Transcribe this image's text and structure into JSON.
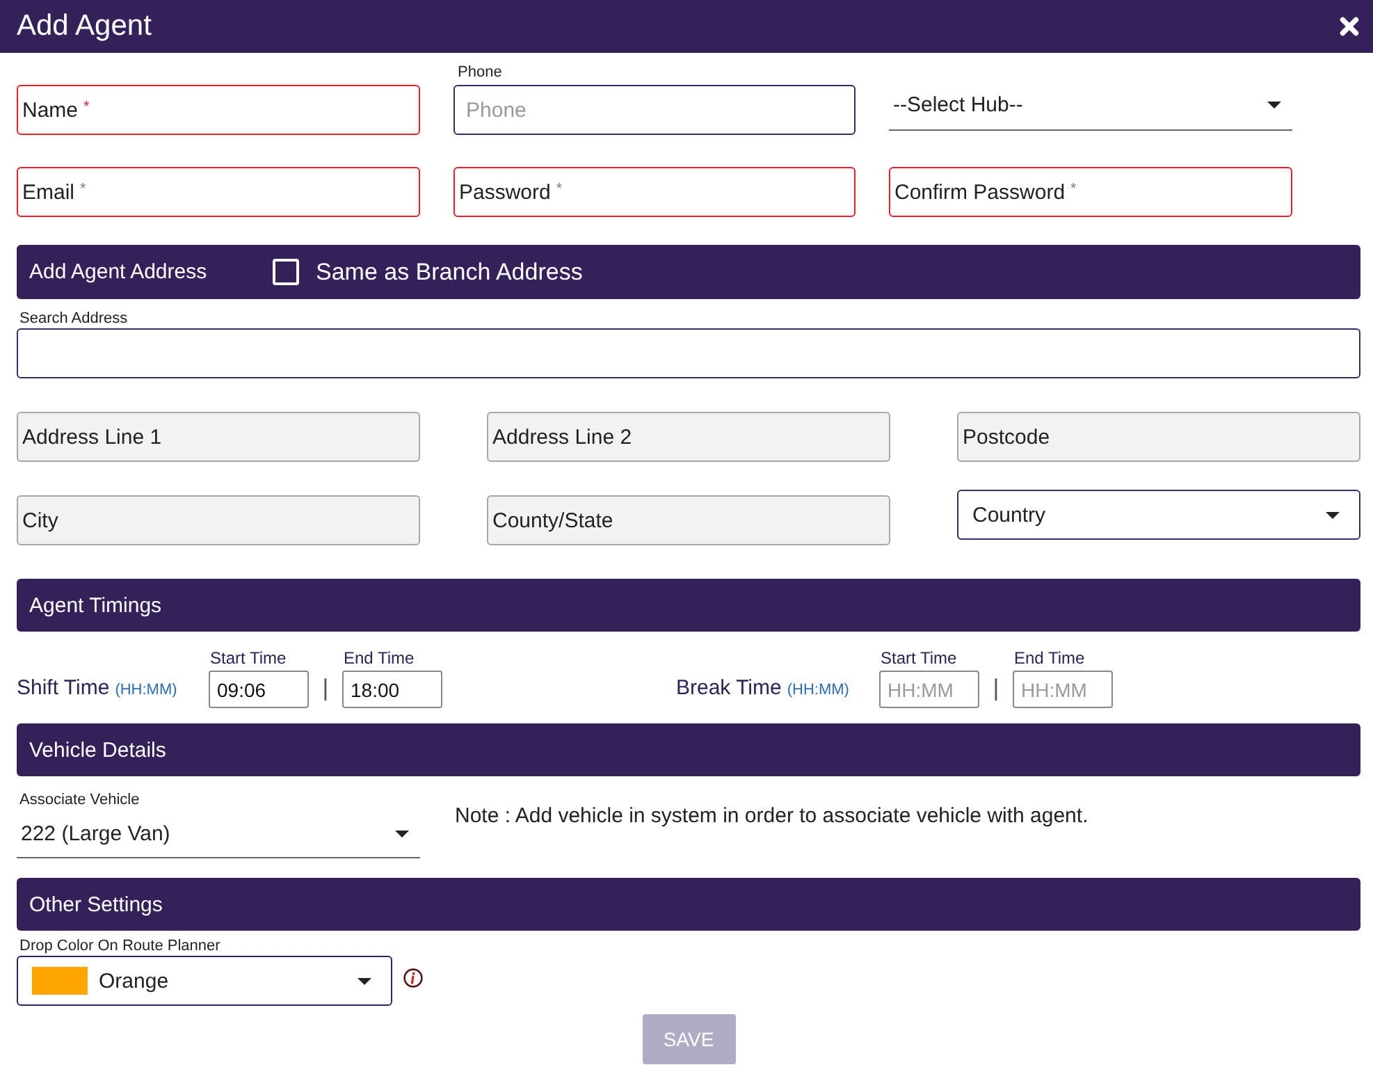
{
  "dialog": {
    "title": "Add Agent"
  },
  "account_fields": [
    {
      "kind": "text",
      "text": "Name",
      "required_mark": {
        "text": "*",
        "color": "#e3262e"
      },
      "invalid": true
    },
    {
      "kind": "input",
      "label": "Phone",
      "placeholder": "Phone",
      "invalid": false
    },
    {
      "kind": "select",
      "value": "--Select Hub--"
    },
    {
      "kind": "text",
      "text": "Email",
      "required_mark": {
        "text": "*",
        "color": "#808080"
      },
      "invalid": true
    },
    {
      "kind": "text",
      "text": "Password",
      "required_mark": {
        "text": "*",
        "color": "#808080"
      },
      "invalid": true
    },
    {
      "kind": "text",
      "text": "Confirm Password",
      "required_mark": {
        "text": "*",
        "color": "#808080"
      },
      "invalid": true
    }
  ],
  "address_section": {
    "title": "Add Agent Address",
    "same_as_branch": {
      "label": "Same as Branch Address",
      "checked": false
    },
    "search": {
      "label": "Search Address"
    },
    "fields": [
      {
        "kind": "text",
        "text": "Address Line 1",
        "disabled": true
      },
      {
        "kind": "text",
        "text": "Address Line 2",
        "disabled": true
      },
      {
        "kind": "text",
        "text": "Postcode",
        "disabled": true
      },
      {
        "kind": "text",
        "text": "City",
        "disabled": true
      },
      {
        "kind": "text",
        "text": "County/State",
        "disabled": true
      },
      {
        "kind": "select",
        "text": "Country",
        "disabled": false
      }
    ]
  },
  "timings_section": {
    "title": "Agent Timings",
    "groups": [
      {
        "label": "Shift Time",
        "hint": "(HH:MM)",
        "separator": "|",
        "times": [
          {
            "label": "Start Time",
            "value": "09:06"
          },
          {
            "label": "End Time",
            "value": "18:00"
          }
        ]
      },
      {
        "label": "Break Time",
        "hint": "(HH:MM)",
        "separator": "|",
        "times": [
          {
            "label": "Start Time",
            "placeholder": "HH:MM"
          },
          {
            "label": "End Time",
            "placeholder": "HH:MM"
          }
        ]
      }
    ]
  },
  "vehicle_section": {
    "title": "Vehicle Details",
    "vehicle": {
      "label": "Associate Vehicle",
      "value": "222 (Large Van)"
    },
    "note": "Note : Add vehicle in system in order to associate vehicle with agent."
  },
  "other_section": {
    "title": "Other Settings",
    "drop_color": {
      "label": "Drop Color On Route Planner",
      "value": "Orange",
      "color": "#ffa500"
    }
  },
  "save_button": {
    "label": "SAVE",
    "disabled": true
  }
}
